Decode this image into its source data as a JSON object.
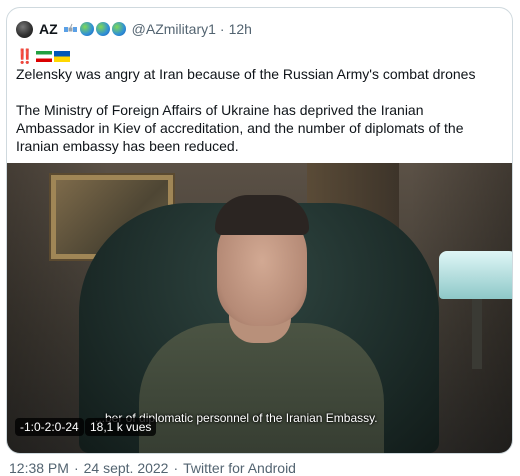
{
  "tweet": {
    "display_name": "AZ",
    "handle": "@AZmilitary1",
    "separator": "·",
    "relative_time": "12h",
    "badges": [
      "satellite-icon",
      "globe-icon",
      "globe-icon",
      "globe-icon"
    ],
    "lead_exclamation": "‼️",
    "lead_flags": [
      "iran-flag-icon",
      "ukraine-flag-icon"
    ],
    "line1": "Zelensky was angry at Iran because of the Russian Army's combat drones",
    "paragraph2": "The Ministry of Foreign Affairs of Ukraine has deprived the Iranian Ambassador in Kiev of accreditation, and the number of diplomats of the Iranian embassy has been reduced."
  },
  "video": {
    "subtitle": "...ber of diplomatic personnel of the Iranian Embassy.",
    "duration": "-1:0-2:0-24",
    "views": "18,1 k vues"
  },
  "footer": {
    "time": "12:38 PM",
    "date": "24 sept. 2022",
    "client": "Twitter for Android",
    "separator": "·"
  },
  "colors": {
    "text": "#0f1419",
    "secondary": "#536471",
    "border": "#cfd9de",
    "alert": "#e0245e"
  }
}
